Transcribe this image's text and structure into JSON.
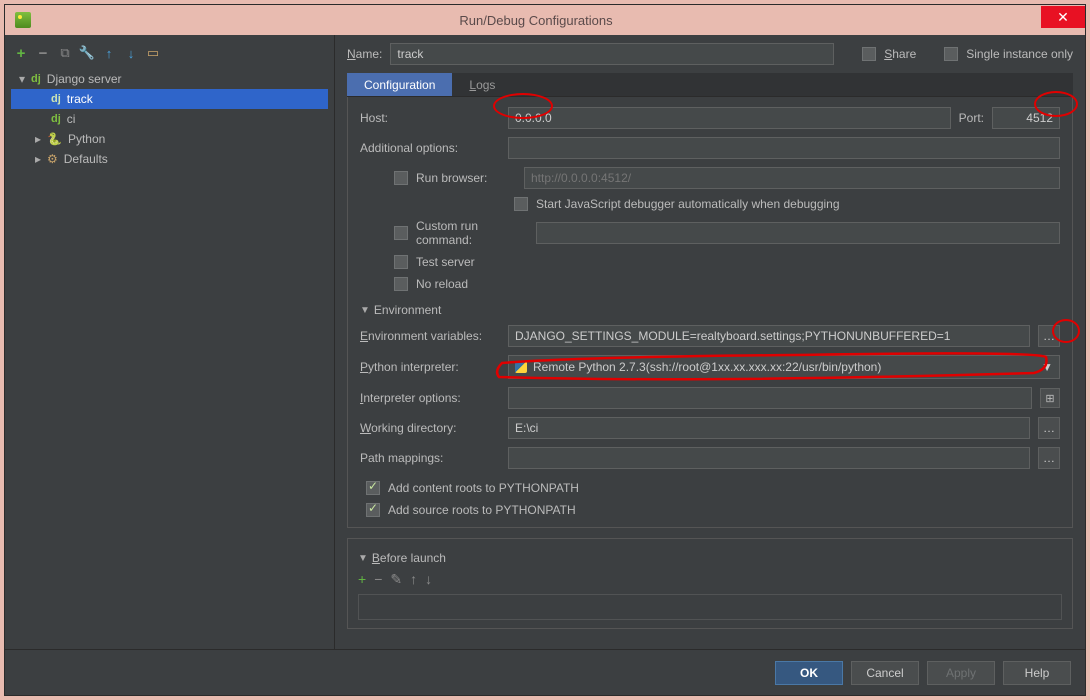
{
  "title": "Run/Debug Configurations",
  "sidebar": {
    "nodes": {
      "django": "Django server",
      "track": "track",
      "ci": "ci",
      "python": "Python",
      "defaults": "Defaults"
    }
  },
  "name_label": "Name:",
  "name_value": "track",
  "share_label": "Share",
  "single_label": "Single instance only",
  "tabs": {
    "config": "Configuration",
    "logs": "Logs"
  },
  "form": {
    "host_label": "Host:",
    "host_value": "0.0.0.0",
    "port_label": "Port:",
    "port_value": "4512",
    "addl_label": "Additional options:",
    "runbrowser_label": "Run browser:",
    "runbrowser_placeholder": "http://0.0.0.0:4512/",
    "jsdbg_label": "Start JavaScript debugger automatically when debugging",
    "customrun_label": "Custom run command:",
    "testserver_label": "Test server",
    "noreload_label": "No reload",
    "env_header": "Environment",
    "envvars_label": "Environment variables:",
    "envvars_value": "DJANGO_SETTINGS_MODULE=realtyboard.settings;PYTHONUNBUFFERED=1",
    "interp_label": "Python interpreter:",
    "interp_value": "Remote Python 2.7.3(ssh://root@1xx.xx.xxx.xx:22/usr/bin/python)",
    "interpopts_label": "Interpreter options:",
    "wd_label": "Working directory:",
    "wd_value": "E:\\ci",
    "pm_label": "Path mappings:",
    "addcontent_label": "Add content roots to PYTHONPATH",
    "addsource_label": "Add source roots to PYTHONPATH"
  },
  "beforelaunch_label": "Before launch",
  "buttons": {
    "ok": "OK",
    "cancel": "Cancel",
    "apply": "Apply",
    "help": "Help"
  }
}
